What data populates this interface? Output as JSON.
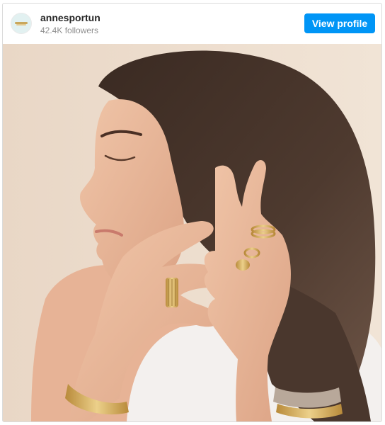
{
  "post": {
    "username": "annesportun",
    "followers": "42.4K followers",
    "view_profile_label": "View profile",
    "avatar_icon": "brand-logo-icon",
    "photo_description_icon": "photo-image",
    "colors": {
      "button": "#0095f6",
      "button_text": "#ffffff",
      "username": "#262626",
      "secondary_text": "#8e8e8e",
      "border": "#dbdbdb"
    }
  }
}
